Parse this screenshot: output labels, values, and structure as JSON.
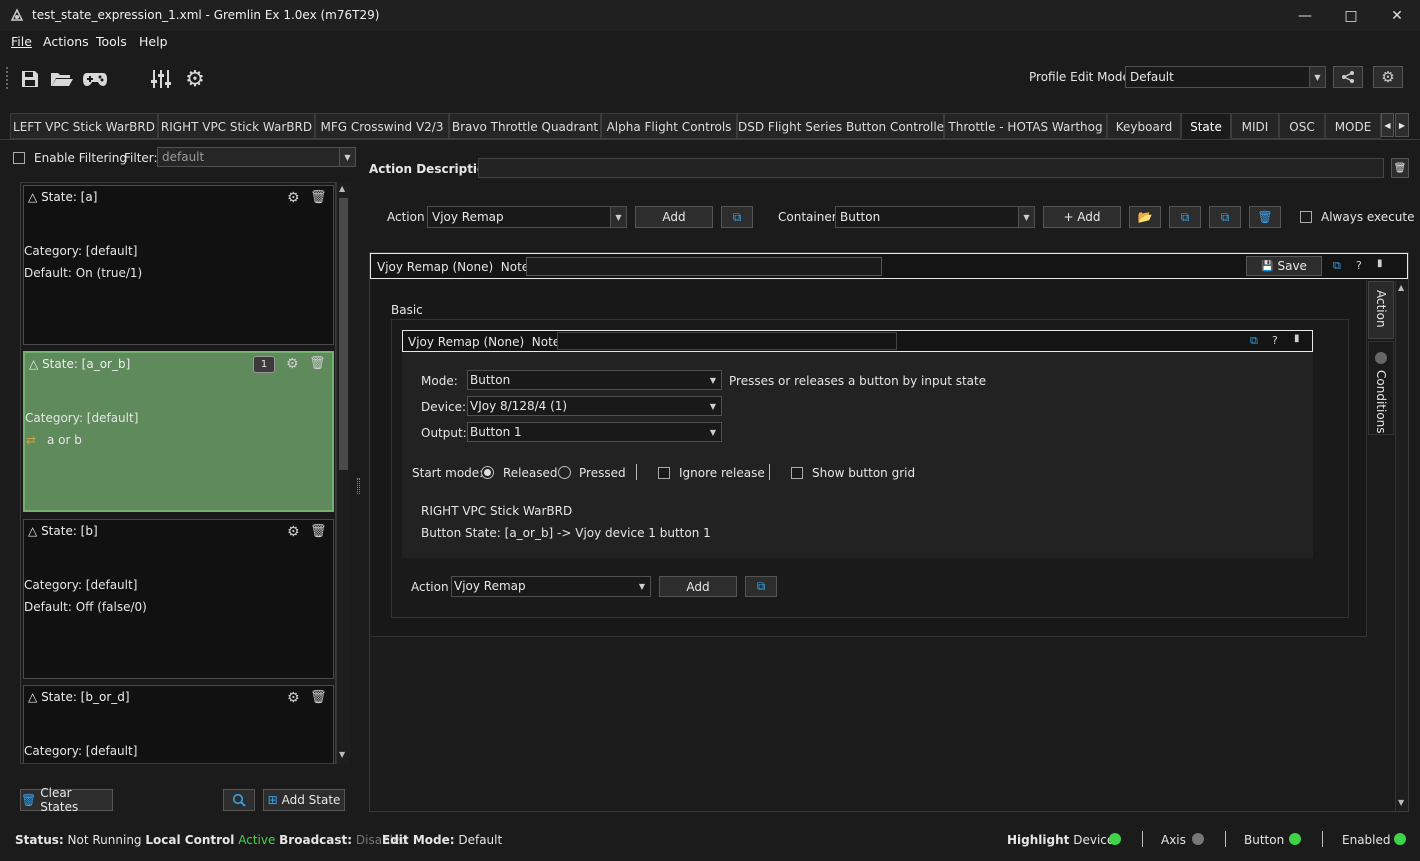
{
  "window": {
    "title": "test_state_expression_1.xml - Gremlin Ex 1.0ex (m76T29)"
  },
  "menu": {
    "items": [
      "File",
      "Actions",
      "Tools",
      "Help"
    ]
  },
  "toolbar": {
    "profile_edit_mode_label": "Profile Edit Mode",
    "profile_edit_mode_value": "Default"
  },
  "tabs": [
    "LEFT VPC Stick WarBRD",
    "RIGHT VPC Stick WarBRD",
    "MFG Crosswind V2/3",
    "Bravo Throttle Quadrant",
    "Alpha Flight Controls",
    "DSD Flight Series Button Controller",
    "Throttle - HOTAS Warthog",
    "Keyboard",
    "State",
    "MIDI",
    "OSC",
    "MODE"
  ],
  "filter": {
    "enable_label": "Enable Filtering",
    "filter_label": "Filter:",
    "filter_value": "default"
  },
  "states": [
    {
      "header": "State: [a]",
      "line1": "Category: [default]",
      "line2": "Default: On (true/1)"
    },
    {
      "header": "State: [a_or_b]",
      "badge": "1",
      "line1": "Category: [default]",
      "line2": "a or b"
    },
    {
      "header": "State: [b]",
      "line1": "Category: [default]",
      "line2": "Default: Off (false/0)"
    },
    {
      "header": "State: [b_or_d]",
      "line1": "Category: [default]"
    }
  ],
  "left_buttons": {
    "clear_states": "Clear States",
    "add_state": "Add State"
  },
  "action_description_label": "Action Description",
  "action_row": {
    "action_label": "Action",
    "action_value": "Vjoy Remap",
    "add": "Add",
    "container_label": "Container",
    "container_value": "Button",
    "container_add": "+ Add",
    "always_execute": "Always execute"
  },
  "outer_frame": {
    "title": "Vjoy Remap (None)",
    "notes_label": "Notes:",
    "save": "Save",
    "help": "?"
  },
  "side_tabs": {
    "action": "Action",
    "conditions": "Conditions"
  },
  "basic_label": "Basic",
  "inner_frame": {
    "title": "Vjoy Remap (None)",
    "notes_label": "Notes:",
    "help": "?"
  },
  "vjoy": {
    "mode_label": "Mode:",
    "mode_value": "Button",
    "mode_desc": "Presses or releases a button by input state",
    "device_label": "Device:",
    "device_value": "VJoy 8/128/4 (1)",
    "output_label": "Output:",
    "output_value": "Button 1",
    "start_mode_label": "Start mode:",
    "released": "Released",
    "pressed": "Pressed",
    "ignore_release": "Ignore release",
    "show_grid": "Show button grid",
    "info1": "RIGHT VPC Stick WarBRD",
    "info2": "Button State: [a_or_b] -> Vjoy device 1 button 1"
  },
  "inner_action_row": {
    "label": "Action",
    "value": "Vjoy Remap",
    "add": "Add"
  },
  "status": {
    "status_label": "Status:",
    "status_value": "Not Running",
    "local_control_label": "Local Control",
    "local_control_value": "Active",
    "broadcast_label": "Broadcast:",
    "broadcast_value": "Disabled",
    "edit_mode_label": "Edit Mode:",
    "edit_mode_value": "Default",
    "highlight_label": "Highlight",
    "device": "Device",
    "axis": "Axis",
    "button": "Button",
    "enabled": "Enabled"
  },
  "colors": {
    "active_green": "#3fd34a",
    "selected_card": "#5e8a5c",
    "grey_dot": "#777777",
    "accent_blue": "#3aa0e8"
  }
}
